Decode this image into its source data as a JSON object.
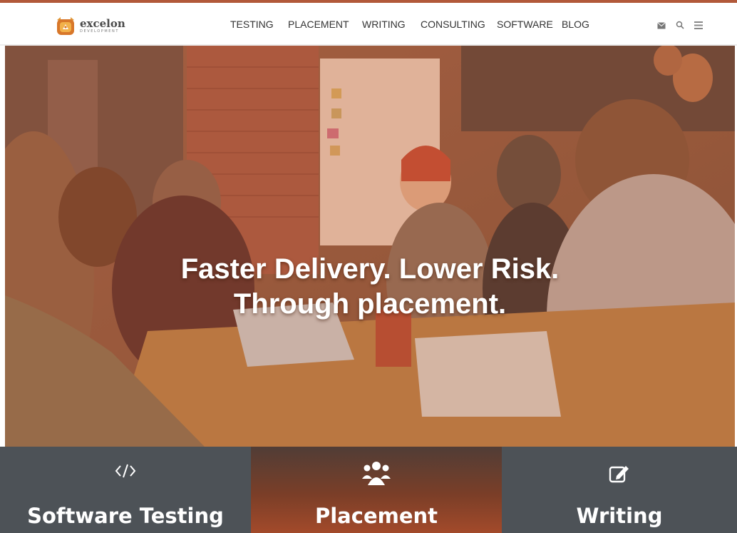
{
  "brand": {
    "name": "excelon",
    "tagline": "DEVELOPMENT",
    "logo_icon": "excelon-logo-icon",
    "accent_color": "#b2593a"
  },
  "nav": {
    "items": [
      {
        "label": "TESTING"
      },
      {
        "label": "PLACEMENT"
      },
      {
        "label": "WRITING"
      },
      {
        "label": "CONSULTING"
      },
      {
        "label": "SOFTWARE"
      },
      {
        "label": "BLOG"
      }
    ],
    "utility_icons": [
      "mail-icon",
      "search-icon",
      "menu-icon"
    ]
  },
  "hero": {
    "line1": "Faster Delivery. Lower Risk.",
    "line2": "Through placement.",
    "overlay_color": "#c8704a"
  },
  "services": [
    {
      "label": "Software Testing",
      "icon": "code-icon",
      "color": "#4d5257"
    },
    {
      "label": "Placement",
      "icon": "users-icon",
      "color": "#8a4a30"
    },
    {
      "label": "Writing",
      "icon": "edit-icon",
      "color": "#4d5257"
    }
  ]
}
